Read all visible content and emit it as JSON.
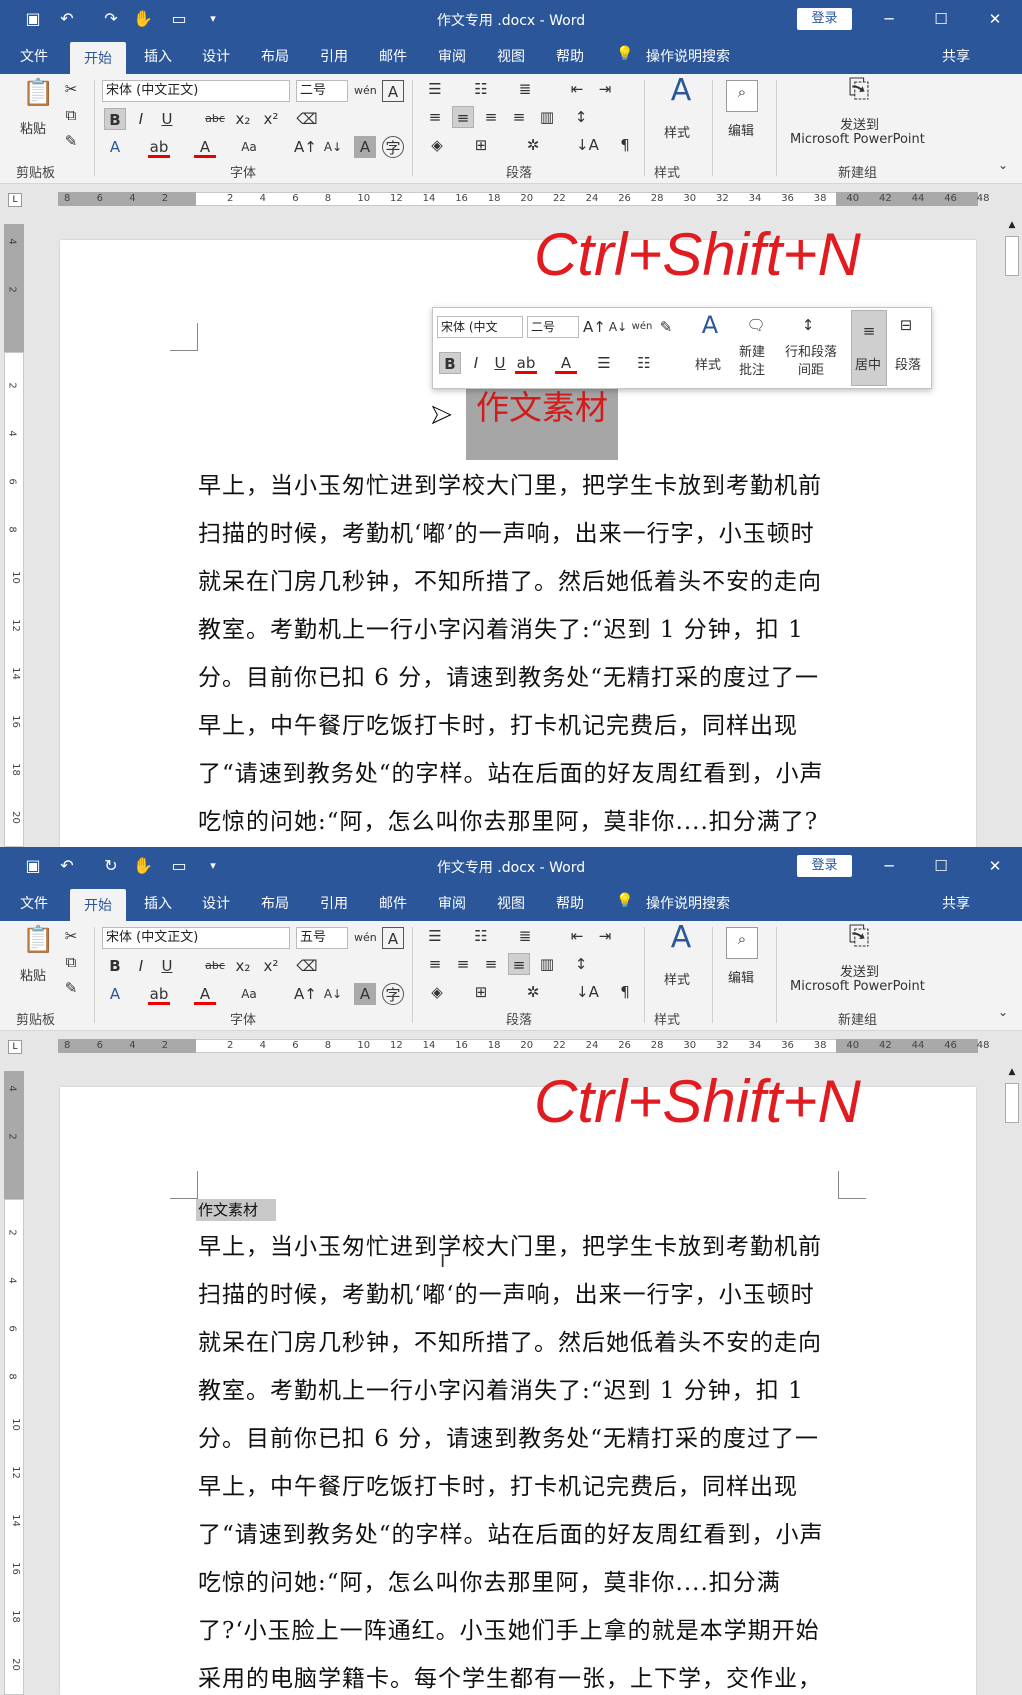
{
  "title": "作文专用 .docx  -  Word",
  "login": "登录",
  "share": "共享",
  "tabs": [
    "文件",
    "开始",
    "插入",
    "设计",
    "布局",
    "引用",
    "邮件",
    "审阅",
    "视图",
    "帮助"
  ],
  "search_hint": "操作说明搜索",
  "ribbon": {
    "paste": "粘贴",
    "clipboard": "剪贴板",
    "font_group": "字体",
    "paragraph_group": "段落",
    "styles_group": "样式",
    "styles": "样式",
    "edit": "编辑",
    "send": "发送到",
    "ppt": "Microsoft PowerPoint",
    "new_group": "新建组",
    "font_name": "宋体 (中文正文)"
  },
  "panels": [
    {
      "font_size": "二号",
      "shortcut": "Ctrl+Shift+N",
      "heading": "作文素材"
    },
    {
      "font_size": "五号",
      "shortcut": "Ctrl+Shift+N",
      "heading": "作文素材"
    }
  ],
  "mini_toolbar": {
    "font": "宋体 (中文",
    "size": "二号",
    "styles": "样式",
    "new_comment": "新建\n批注",
    "line_spacing": "行和段落\n间距",
    "center": "居中",
    "paragraph": "段落"
  },
  "ruler_ticks": [
    "8",
    "6",
    "4",
    "2",
    "",
    "2",
    "4",
    "6",
    "8",
    "10",
    "12",
    "14",
    "16",
    "18",
    "20",
    "22",
    "24",
    "26",
    "28",
    "30",
    "32",
    "34",
    "36",
    "38",
    "40",
    "42",
    "44",
    "46",
    "48"
  ],
  "vruler_ticks": [
    "4",
    "2",
    "",
    "2",
    "4",
    "6",
    "8",
    "10",
    "12",
    "14",
    "16",
    "18",
    "20"
  ],
  "body_text_1": "早上，当小玉匆忙进到学校大门里，把学生卡放到考勤机前扫描的时候，考勤机‘嘟’的一声响，出来一行字，小玉顿时就呆在门房几秒钟，不知所措了。然后她低着头不安的走向教室。考勤机上一行小字闪着消失了:“迟到 1 分钟，扣 1 分。目前你已扣 6 分，请速到教务处“无精打采的度过了一早上，中午餐厅吃饭打卡时，打卡机记完费后，同样出现了“请速到教务处“的字样。站在后面的好友周红看到，小声吃惊的问她:“阿，怎么叫你去那里阿，莫非你....扣分满了?",
  "body_text_2": "早上，当小玉匆忙进到学校大门里，把学生卡放到考勤机前扫描的时候，考勤机‘嘟‘的一声响，出来一行字，小玉顿时就呆在门房几秒钟，不知所措了。然后她低着头不安的走向教室。考勤机上一行小字闪着消失了:“迟到 1 分钟，扣 1 分。目前你已扣 6 分，请速到教务处“无精打采的度过了一早上，中午餐厅吃饭打卡时，打卡机记完费后，同样出现了“请速到教务处“的字样。站在后面的好友周红看到，小声吃惊的问她:“阿，怎么叫你去那里阿，莫非你....扣分满了?‘小玉脸上一阵通红。小玉她们手上拿的就是本学期开始采用的电脑学籍卡。每个学生都有一张，上下学，交作业，正"
}
